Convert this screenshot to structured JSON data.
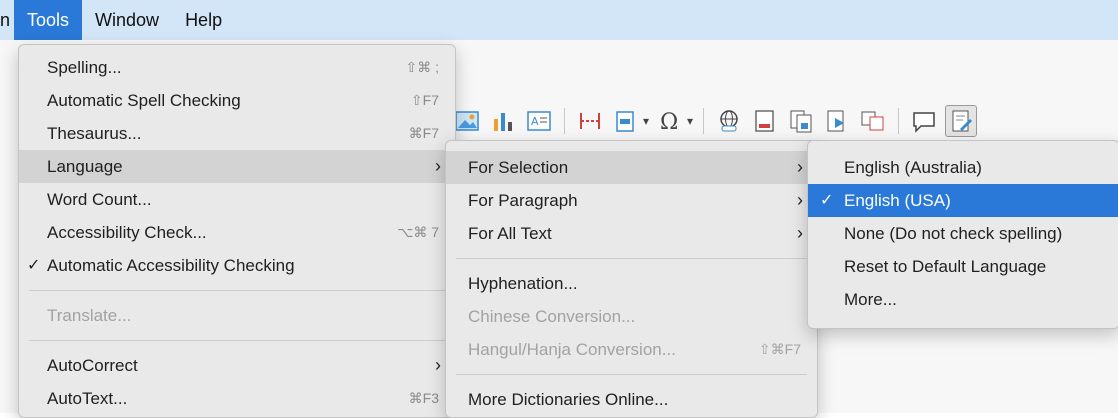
{
  "menubar": {
    "items": [
      {
        "label": "n"
      },
      {
        "label": "Tools"
      },
      {
        "label": "Window"
      },
      {
        "label": "Help"
      }
    ]
  },
  "tools_menu": {
    "items": [
      {
        "label": "Spelling...",
        "shortcut": "⇧⌘ ;"
      },
      {
        "label": "Automatic Spell Checking",
        "shortcut": "⇧F7"
      },
      {
        "label": "Thesaurus...",
        "shortcut": "⌘F7"
      },
      {
        "label": "Language",
        "submenu": true
      },
      {
        "label": "Word Count..."
      },
      {
        "label": "Accessibility Check...",
        "shortcut": "⌥⌘ 7"
      },
      {
        "label": "Automatic Accessibility Checking",
        "checked": true
      },
      {
        "label": "Translate...",
        "disabled": true
      },
      {
        "label": "AutoCorrect",
        "submenu": true
      },
      {
        "label": "AutoText...",
        "shortcut": "⌘F3"
      }
    ]
  },
  "language_menu": {
    "items": [
      {
        "label": "For Selection",
        "submenu": true
      },
      {
        "label": "For Paragraph",
        "submenu": true
      },
      {
        "label": "For All Text",
        "submenu": true
      },
      {
        "label": "Hyphenation..."
      },
      {
        "label": "Chinese Conversion...",
        "disabled": true
      },
      {
        "label": "Hangul/Hanja Conversion...",
        "shortcut": "⇧⌘F7",
        "disabled": true
      },
      {
        "label": "More Dictionaries Online..."
      }
    ]
  },
  "language_options_menu": {
    "items": [
      {
        "label": "English (Australia)"
      },
      {
        "label": "English (USA)",
        "checked": true,
        "selected": true
      },
      {
        "label": "None (Do not check spelling)"
      },
      {
        "label": "Reset to Default Language"
      },
      {
        "label": "More..."
      }
    ]
  },
  "symbols": {
    "check": "✓",
    "arrow": "›"
  },
  "colors": {
    "menubar": "#d2e6f8",
    "accent": "#2a79d8",
    "menu_bg": "#e9e9e9"
  }
}
